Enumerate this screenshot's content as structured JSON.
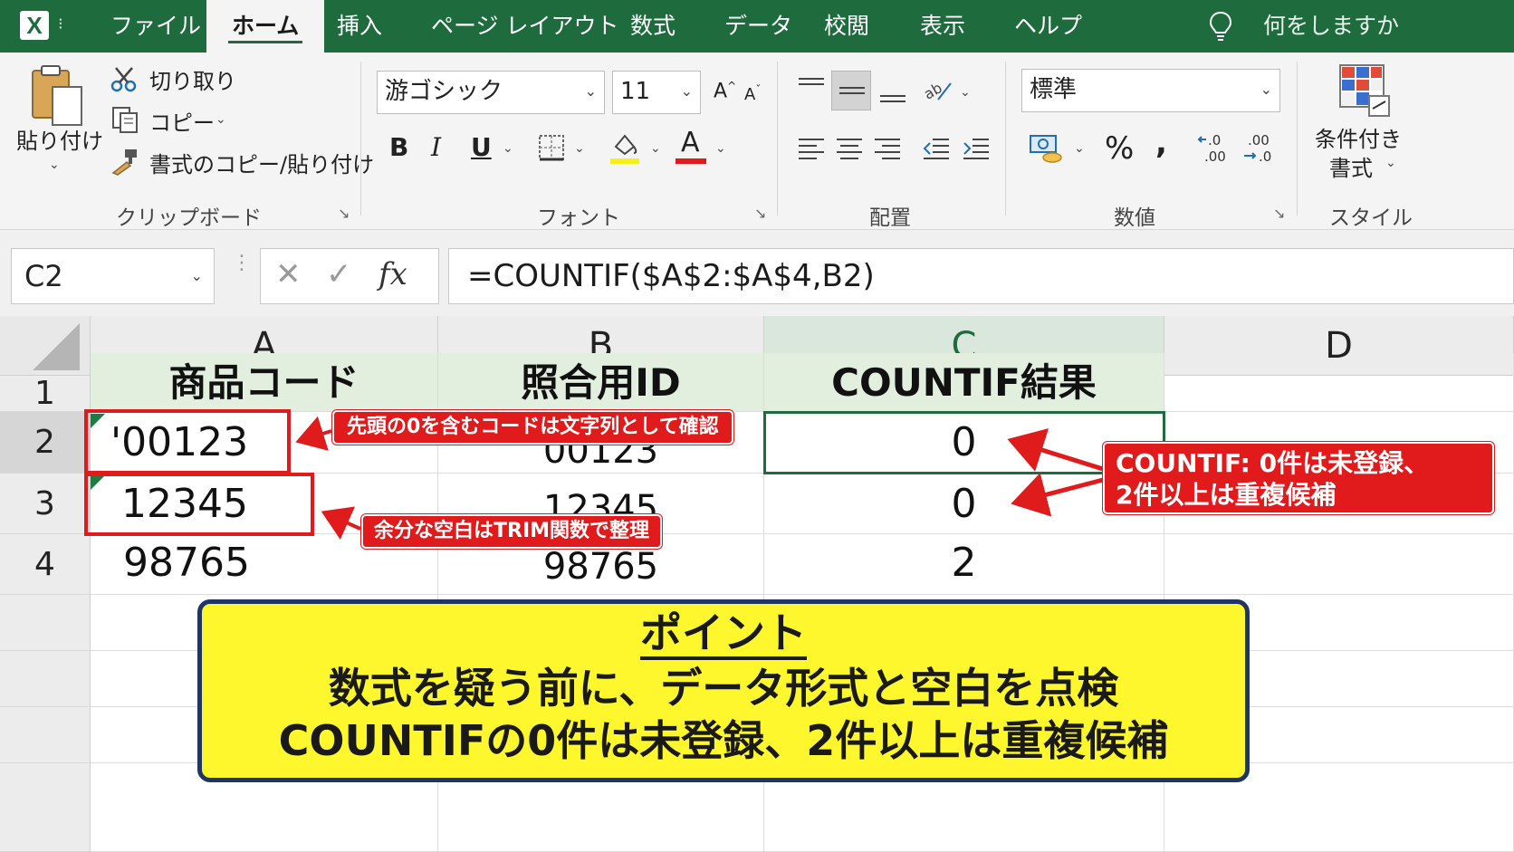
{
  "menu": {
    "tabs": [
      "ファイル",
      "ホーム",
      "挿入",
      "ページ レイアウト",
      "数式",
      "データ",
      "校閲",
      "表示",
      "ヘルプ"
    ],
    "active_tab": "ホーム",
    "tell_me": "何をしますか"
  },
  "ribbon": {
    "clipboard": {
      "paste": "貼り付け",
      "cut": "切り取り",
      "copy": "コピー",
      "format_painter": "書式のコピー/貼り付け",
      "label": "クリップボード"
    },
    "font": {
      "font_name": "游ゴシック",
      "font_size": "11",
      "bold": "B",
      "italic": "I",
      "underline": "U",
      "font_color_glyph": "A",
      "label": "フォント"
    },
    "alignment": {
      "label": "配置"
    },
    "number": {
      "format": "標準",
      "percent": "%",
      "comma": ",",
      "label": "数値"
    },
    "styles": {
      "conditional_line1": "条件付き",
      "conditional_line2": "書式",
      "label": "スタイル"
    }
  },
  "formula_bar": {
    "name_box": "C2",
    "formula": "=COUNTIF($A$2:$A$4,B2)"
  },
  "sheet": {
    "columns": [
      "A",
      "B",
      "C",
      "D"
    ],
    "selected_column": "C",
    "rows": [
      "1",
      "2",
      "3",
      "4"
    ],
    "headers": [
      "商品コード",
      "照合用ID",
      "COUNTIF結果"
    ],
    "data": [
      [
        "'00123",
        "00123",
        "0"
      ],
      [
        "12345",
        "12345",
        "0"
      ],
      [
        "98765",
        "98765",
        "2"
      ]
    ]
  },
  "annotations": {
    "leading_zero": "先頭の0を含むコードは文字列として確認",
    "trim": "余分な空白はTRIM関数で整理",
    "countif_line1": "COUNTIF: 0件は未登録、",
    "countif_line2": "2件以上は重複候補"
  },
  "point_box": {
    "title": "ポイント",
    "line1": "数式を疑う前に、データ形式と空白を点検",
    "line2": "COUNTIFの0件は未登録、2件以上は重複候補"
  },
  "colors": {
    "excel_green": "#1e6b3e",
    "annotation_red": "#e11b1b",
    "highlight_yellow": "#fff72e",
    "header_fill": "#e2efdf"
  }
}
